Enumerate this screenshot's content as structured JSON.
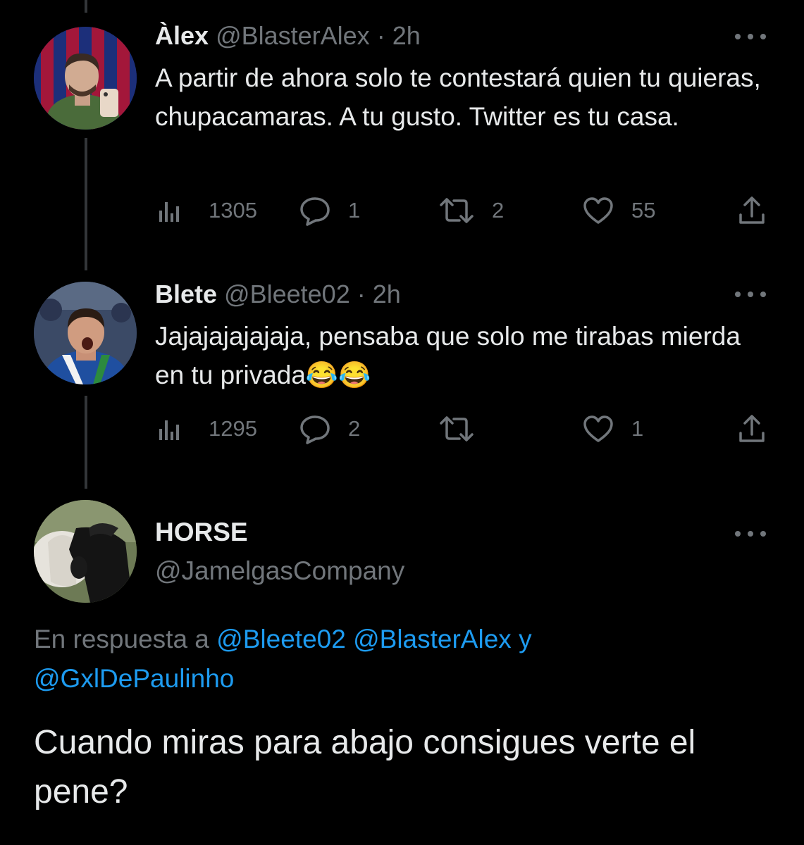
{
  "tweets": [
    {
      "name": "Àlex",
      "handle": "@BlasterAlex",
      "time": "· 2h",
      "text": "A partir de ahora solo te contestará quien tu quieras, chupacamaras. A tu gusto. Twitter es tu casa.",
      "views": "1305",
      "replies": "1",
      "retweets": "2",
      "likes": "55"
    },
    {
      "name": "Blete",
      "handle": "@Bleete02",
      "time": "· 2h",
      "text": "Jajajajajajaja, pensaba que solo me tirabas mierda en tu privada😂😂",
      "views": "1295",
      "replies": "2",
      "retweets": "",
      "likes": "1"
    }
  ],
  "main_tweet": {
    "name": "HORSE",
    "handle": "@JamelgasCompany",
    "reply_prefix": "En respuesta a",
    "mention_1": "@Bleete02",
    "mention_2": "@BlasterAlex",
    "reply_joiner": "y",
    "mention_3": "@GxlDePaulinho",
    "text": "Cuando miras para abajo consigues verte el pene?"
  },
  "colors": {
    "background": "#000000",
    "text": "#e7e9ea",
    "secondary": "#71767b",
    "link": "#1d9bf0"
  }
}
